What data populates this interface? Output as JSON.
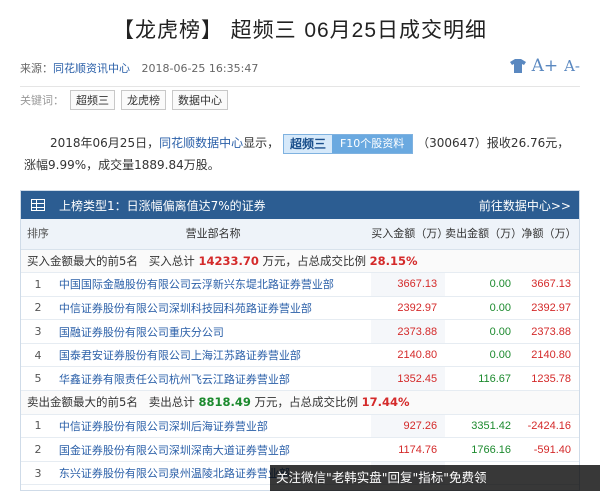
{
  "page": {
    "title_left": "【龙虎榜】",
    "title_stock": "超频三",
    "title_date": "06月25日成交明细"
  },
  "meta": {
    "source_label": "来源：",
    "source": "同花顺资讯中心",
    "time": "2018-06-25 16:35:47",
    "font_inc": "A+",
    "font_dec": "A-"
  },
  "keywords": {
    "label": "关键词：",
    "tags": [
      "超频三",
      "龙虎榜",
      "数据中心"
    ]
  },
  "summary": {
    "pre": "2018年06月25日，",
    "link": "同花顺数据中心",
    "mid": "显示，",
    "stock_name": "超频三",
    "f10": "F10个股资料",
    "post": "（300647）报收26.76元，",
    "line2": "涨幅9.99%，成交量1889.84万股。"
  },
  "panel": {
    "type_label": "上榜类型1：日涨幅偏离值达7%的证券",
    "more": "前往数据中心>>",
    "headers": {
      "rank": "排序",
      "dept": "营业部名称",
      "buy": "买入金额（万）",
      "sell": "卖出金额（万）",
      "net": "净额（万）"
    },
    "buy_summary": {
      "label": "买入金额最大的前5名",
      "total_label": "买入总计",
      "total": "14233.70",
      "unit_text": "万元，占总成交比例",
      "ratio": "28.15%"
    },
    "buy_rows": [
      {
        "idx": "1",
        "name": "中国国际金融股份有限公司云浮新兴东堤北路证券营业部",
        "buy": "3667.13",
        "sell": "0.00",
        "net": "3667.13"
      },
      {
        "idx": "2",
        "name": "中信证券股份有限公司深圳科技园科苑路证券营业部",
        "buy": "2392.97",
        "sell": "0.00",
        "net": "2392.97"
      },
      {
        "idx": "3",
        "name": "国融证券股份有限公司重庆分公司",
        "buy": "2373.88",
        "sell": "0.00",
        "net": "2373.88"
      },
      {
        "idx": "4",
        "name": "国泰君安证券股份有限公司上海江苏路证券营业部",
        "buy": "2140.80",
        "sell": "0.00",
        "net": "2140.80"
      },
      {
        "idx": "5",
        "name": "华鑫证券有限责任公司杭州飞云江路证券营业部",
        "buy": "1352.45",
        "sell": "116.67",
        "net": "1235.78"
      }
    ],
    "sell_summary": {
      "label": "卖出金额最大的前5名",
      "total_label": "卖出总计",
      "total": "8818.49",
      "unit_text": "万元，占总成交比例",
      "ratio": "17.44%"
    },
    "sell_rows": [
      {
        "idx": "1",
        "name": "中信证券股份有限公司深圳后海证券营业部",
        "buy": "927.26",
        "sell": "3351.42",
        "net": "-2424.16"
      },
      {
        "idx": "2",
        "name": "国金证券股份有限公司深圳深南大道证券营业部",
        "buy": "1174.76",
        "sell": "1766.16",
        "net": "-591.40"
      },
      {
        "idx": "3",
        "name": "东兴证券股份有限公司泉州温陵北路证券营业部",
        "buy": "",
        "sell": "",
        "net": ""
      }
    ]
  },
  "watermark": "关注微信\"老韩实盘\"回复\"指标\"免费领",
  "colors": {
    "bar": "#2c5d92",
    "link": "#2a5fa8",
    "up": "#d42a2a",
    "down": "#1c8a2e"
  }
}
